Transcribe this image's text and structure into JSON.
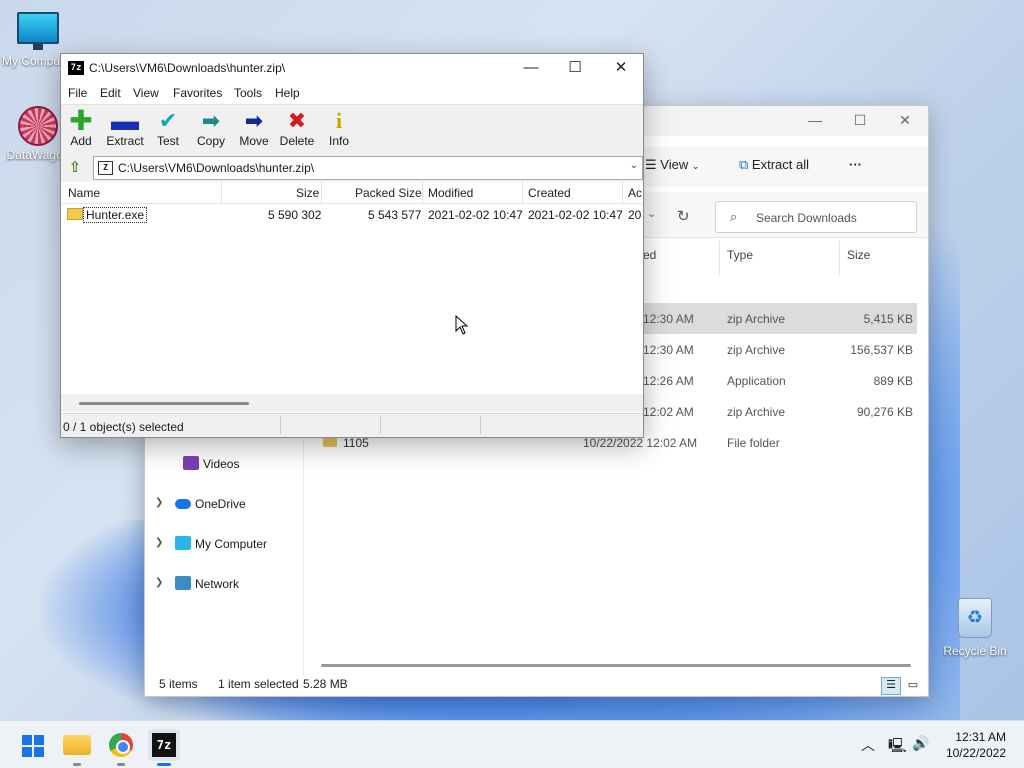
{
  "desktop": {
    "icons": [
      {
        "label": "My Computer"
      },
      {
        "label": "DataWagon"
      },
      {
        "label": "Recycle Bin"
      }
    ]
  },
  "explorer": {
    "toolbar": {
      "view_label": "View",
      "extract_all_label": "Extract all",
      "more_label": "···"
    },
    "search": {
      "placeholder": "Search Downloads"
    },
    "columns": {
      "date_fragment": "ed",
      "type": "Type",
      "size": "Size"
    },
    "rows": [
      {
        "date": "12:30 AM",
        "type": "zip Archive",
        "size": "5,415 KB",
        "selected": true
      },
      {
        "date": "12:30 AM",
        "type": "zip Archive",
        "size": "156,537 KB"
      },
      {
        "date": "12:26 AM",
        "type": "Application",
        "size": "889 KB"
      },
      {
        "date": "12:02 AM",
        "type": "zip Archive",
        "size": "90,276 KB"
      },
      {
        "name": "1105",
        "date": "10/22/2022 12:02 AM",
        "type": "File folder",
        "size": ""
      }
    ],
    "nav": [
      {
        "label": "Videos"
      },
      {
        "label": "OneDrive"
      },
      {
        "label": "My Computer"
      },
      {
        "label": "Network"
      }
    ],
    "status": {
      "count": "5 items",
      "selected": "1 item selected",
      "size": "5.28 MB"
    }
  },
  "sevenzip": {
    "title": "C:\\Users\\VM6\\Downloads\\hunter.zip\\",
    "badge": "7z",
    "menu": [
      "File",
      "Edit",
      "View",
      "Favorites",
      "Tools",
      "Help"
    ],
    "tools": [
      {
        "label": "Add",
        "icon": "plus-icon",
        "color": "#2aa52a"
      },
      {
        "label": "Extract",
        "icon": "minus-icon",
        "color": "#1830b8"
      },
      {
        "label": "Test",
        "icon": "check-icon",
        "color": "#17a7b3"
      },
      {
        "label": "Copy",
        "icon": "copy-arrow-icon",
        "color": "#1c8a87"
      },
      {
        "label": "Move",
        "icon": "move-arrow-icon",
        "color": "#142a8f"
      },
      {
        "label": "Delete",
        "icon": "delete-x-icon",
        "color": "#d21c1c"
      },
      {
        "label": "Info",
        "icon": "info-icon",
        "color": "#c9a400"
      }
    ],
    "path": "C:\\Users\\VM6\\Downloads\\hunter.zip\\",
    "columns": [
      "Name",
      "Size",
      "Packed Size",
      "Modified",
      "Created",
      "Ac"
    ],
    "files": [
      {
        "name": "Hunter.exe",
        "size": "5 590 302",
        "packed": "5 543 577",
        "modified": "2021-02-02 10:47",
        "created": "2021-02-02 10:47",
        "accessed": "20"
      }
    ],
    "status": "0 / 1 object(s) selected"
  },
  "taskbar": {
    "apps": [
      "start-icon",
      "file-explorer-icon",
      "chrome-icon",
      "7zip-icon"
    ],
    "time": "12:31 AM",
    "date": "10/22/2022"
  }
}
